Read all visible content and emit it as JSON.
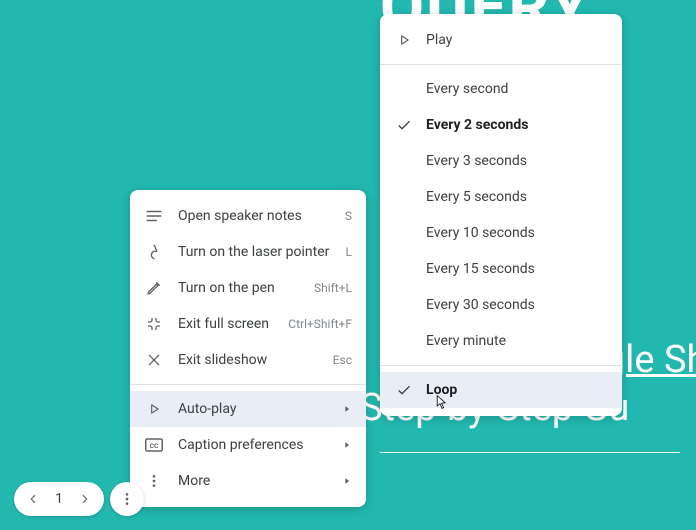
{
  "background": {
    "title": "QUERY",
    "line1": "Learn Google Sh",
    "line2": "Step-by-Step Gu"
  },
  "menu": {
    "items": [
      {
        "icon": "notes",
        "label": "Open speaker notes",
        "shortcut": "S"
      },
      {
        "icon": "laser",
        "label": "Turn on the laser pointer",
        "shortcut": "L"
      },
      {
        "icon": "pen",
        "label": "Turn on the pen",
        "shortcut": "Shift+L"
      },
      {
        "icon": "exitfs",
        "label": "Exit full screen",
        "shortcut": "Ctrl+Shift+F"
      },
      {
        "icon": "close",
        "label": "Exit slideshow",
        "shortcut": "Esc"
      }
    ],
    "autoplay": "Auto-play",
    "captions": "Caption preferences",
    "more": "More"
  },
  "submenu": {
    "play": "Play",
    "intervals": [
      "Every second",
      "Every 2 seconds",
      "Every 3 seconds",
      "Every 5 seconds",
      "Every 10 seconds",
      "Every 15 seconds",
      "Every 30 seconds",
      "Every minute"
    ],
    "selected_interval_index": 1,
    "loop": "Loop",
    "loop_checked": true
  },
  "pager": {
    "current": "1"
  }
}
